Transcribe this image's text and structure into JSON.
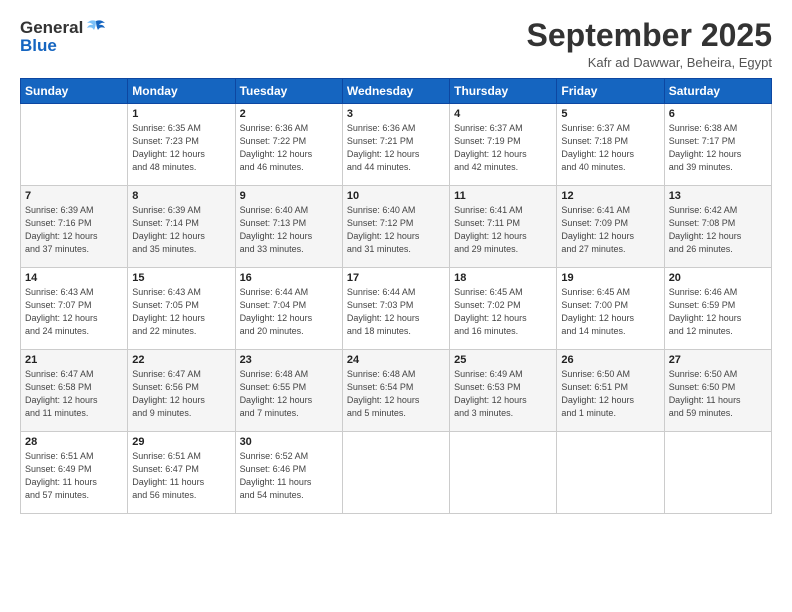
{
  "header": {
    "logo_general": "General",
    "logo_blue": "Blue",
    "title": "September 2025",
    "location": "Kafr ad Dawwar, Beheira, Egypt"
  },
  "days_of_week": [
    "Sunday",
    "Monday",
    "Tuesday",
    "Wednesday",
    "Thursday",
    "Friday",
    "Saturday"
  ],
  "weeks": [
    [
      {
        "day": "",
        "info": ""
      },
      {
        "day": "1",
        "info": "Sunrise: 6:35 AM\nSunset: 7:23 PM\nDaylight: 12 hours\nand 48 minutes."
      },
      {
        "day": "2",
        "info": "Sunrise: 6:36 AM\nSunset: 7:22 PM\nDaylight: 12 hours\nand 46 minutes."
      },
      {
        "day": "3",
        "info": "Sunrise: 6:36 AM\nSunset: 7:21 PM\nDaylight: 12 hours\nand 44 minutes."
      },
      {
        "day": "4",
        "info": "Sunrise: 6:37 AM\nSunset: 7:19 PM\nDaylight: 12 hours\nand 42 minutes."
      },
      {
        "day": "5",
        "info": "Sunrise: 6:37 AM\nSunset: 7:18 PM\nDaylight: 12 hours\nand 40 minutes."
      },
      {
        "day": "6",
        "info": "Sunrise: 6:38 AM\nSunset: 7:17 PM\nDaylight: 12 hours\nand 39 minutes."
      }
    ],
    [
      {
        "day": "7",
        "info": "Sunrise: 6:39 AM\nSunset: 7:16 PM\nDaylight: 12 hours\nand 37 minutes."
      },
      {
        "day": "8",
        "info": "Sunrise: 6:39 AM\nSunset: 7:14 PM\nDaylight: 12 hours\nand 35 minutes."
      },
      {
        "day": "9",
        "info": "Sunrise: 6:40 AM\nSunset: 7:13 PM\nDaylight: 12 hours\nand 33 minutes."
      },
      {
        "day": "10",
        "info": "Sunrise: 6:40 AM\nSunset: 7:12 PM\nDaylight: 12 hours\nand 31 minutes."
      },
      {
        "day": "11",
        "info": "Sunrise: 6:41 AM\nSunset: 7:11 PM\nDaylight: 12 hours\nand 29 minutes."
      },
      {
        "day": "12",
        "info": "Sunrise: 6:41 AM\nSunset: 7:09 PM\nDaylight: 12 hours\nand 27 minutes."
      },
      {
        "day": "13",
        "info": "Sunrise: 6:42 AM\nSunset: 7:08 PM\nDaylight: 12 hours\nand 26 minutes."
      }
    ],
    [
      {
        "day": "14",
        "info": "Sunrise: 6:43 AM\nSunset: 7:07 PM\nDaylight: 12 hours\nand 24 minutes."
      },
      {
        "day": "15",
        "info": "Sunrise: 6:43 AM\nSunset: 7:05 PM\nDaylight: 12 hours\nand 22 minutes."
      },
      {
        "day": "16",
        "info": "Sunrise: 6:44 AM\nSunset: 7:04 PM\nDaylight: 12 hours\nand 20 minutes."
      },
      {
        "day": "17",
        "info": "Sunrise: 6:44 AM\nSunset: 7:03 PM\nDaylight: 12 hours\nand 18 minutes."
      },
      {
        "day": "18",
        "info": "Sunrise: 6:45 AM\nSunset: 7:02 PM\nDaylight: 12 hours\nand 16 minutes."
      },
      {
        "day": "19",
        "info": "Sunrise: 6:45 AM\nSunset: 7:00 PM\nDaylight: 12 hours\nand 14 minutes."
      },
      {
        "day": "20",
        "info": "Sunrise: 6:46 AM\nSunset: 6:59 PM\nDaylight: 12 hours\nand 12 minutes."
      }
    ],
    [
      {
        "day": "21",
        "info": "Sunrise: 6:47 AM\nSunset: 6:58 PM\nDaylight: 12 hours\nand 11 minutes."
      },
      {
        "day": "22",
        "info": "Sunrise: 6:47 AM\nSunset: 6:56 PM\nDaylight: 12 hours\nand 9 minutes."
      },
      {
        "day": "23",
        "info": "Sunrise: 6:48 AM\nSunset: 6:55 PM\nDaylight: 12 hours\nand 7 minutes."
      },
      {
        "day": "24",
        "info": "Sunrise: 6:48 AM\nSunset: 6:54 PM\nDaylight: 12 hours\nand 5 minutes."
      },
      {
        "day": "25",
        "info": "Sunrise: 6:49 AM\nSunset: 6:53 PM\nDaylight: 12 hours\nand 3 minutes."
      },
      {
        "day": "26",
        "info": "Sunrise: 6:50 AM\nSunset: 6:51 PM\nDaylight: 12 hours\nand 1 minute."
      },
      {
        "day": "27",
        "info": "Sunrise: 6:50 AM\nSunset: 6:50 PM\nDaylight: 11 hours\nand 59 minutes."
      }
    ],
    [
      {
        "day": "28",
        "info": "Sunrise: 6:51 AM\nSunset: 6:49 PM\nDaylight: 11 hours\nand 57 minutes."
      },
      {
        "day": "29",
        "info": "Sunrise: 6:51 AM\nSunset: 6:47 PM\nDaylight: 11 hours\nand 56 minutes."
      },
      {
        "day": "30",
        "info": "Sunrise: 6:52 AM\nSunset: 6:46 PM\nDaylight: 11 hours\nand 54 minutes."
      },
      {
        "day": "",
        "info": ""
      },
      {
        "day": "",
        "info": ""
      },
      {
        "day": "",
        "info": ""
      },
      {
        "day": "",
        "info": ""
      }
    ]
  ]
}
